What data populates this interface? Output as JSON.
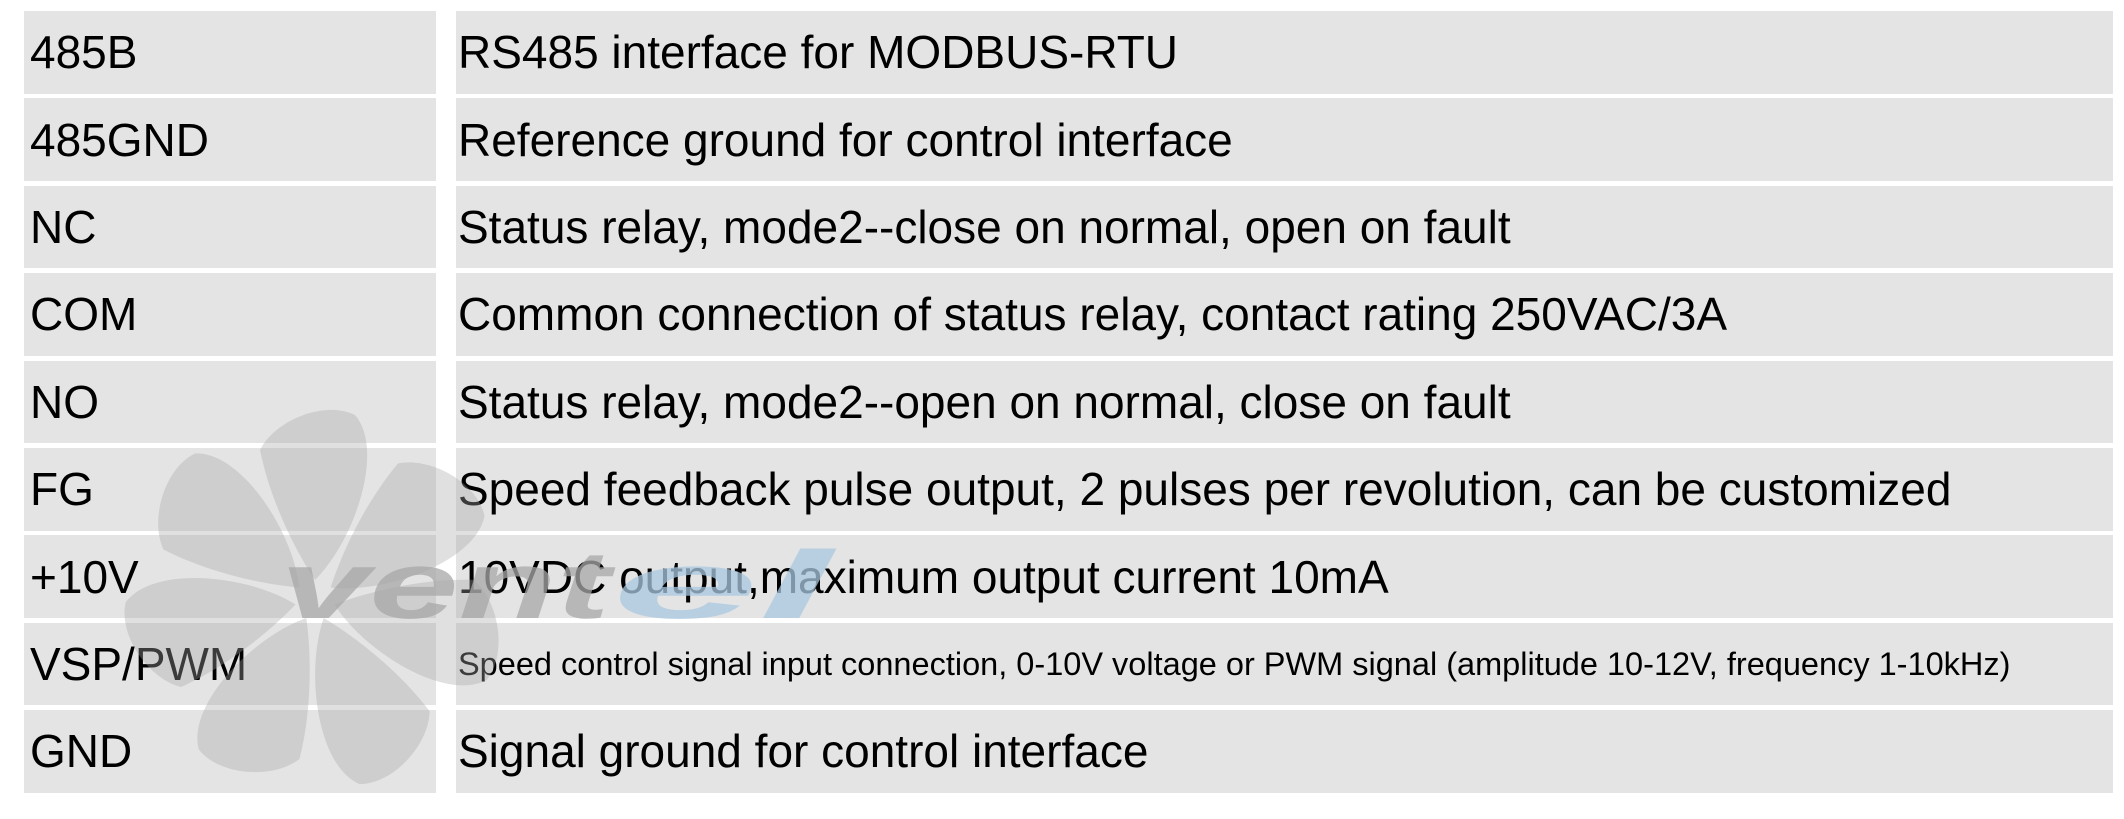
{
  "rows": [
    {
      "pin": "485B",
      "description": "RS485 interface for MODBUS-RTU"
    },
    {
      "pin": "485GND",
      "description": "Reference ground for control interface"
    },
    {
      "pin": "NC",
      "description": "Status relay, mode2--close on normal, open on fault"
    },
    {
      "pin": "COM",
      "description": "Common connection of status relay, contact rating 250VAC/3A"
    },
    {
      "pin": "NO",
      "description": "Status relay, mode2--open on normal, close on fault"
    },
    {
      "pin": "FG",
      "description": "Speed feedback pulse output, 2 pulses per revolution, can be customized"
    },
    {
      "pin": "+10V",
      "description": "10VDC output,maximum output current 10mA"
    },
    {
      "pin": "VSP/PWM",
      "description": "Speed control signal input connection, 0-10V voltage or PWM signal (amplitude 10-12V, frequency 1-10kHz)"
    },
    {
      "pin": "GND",
      "description": "Signal ground for control interface"
    }
  ],
  "watermark": {
    "logo_text_gray": "vent",
    "logo_text_blue": "el",
    "icon": "fan-icon",
    "colors": {
      "gray": "#a8a8a8",
      "blue": "#a9c8e0"
    }
  },
  "colors": {
    "cell_background": "#e4e4e4",
    "text": "#000000"
  }
}
